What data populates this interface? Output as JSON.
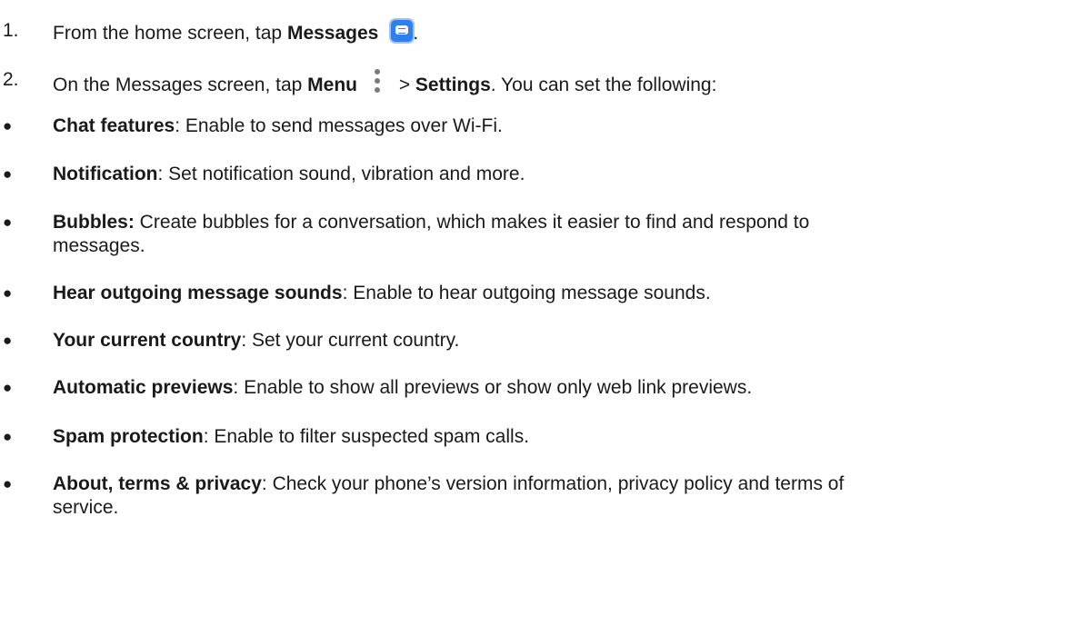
{
  "steps": [
    {
      "number": "1.",
      "prefix": "From the home screen, tap ",
      "bold": "Messages",
      "icon": "messages-icon",
      "suffix": "."
    },
    {
      "number": "2.",
      "prefix": "On the Messages screen, tap ",
      "bold": "Menu",
      "icon": "more-vert-icon",
      "middle": " > ",
      "bold2": "Settings",
      "suffix": ". You can set the following:"
    }
  ],
  "bullet_symbol": "●",
  "settings": [
    {
      "term": "Chat features",
      "desc": ": Enable to send messages over Wi-Fi."
    },
    {
      "term": "Notification",
      "desc": ": Set notification sound, vibration and more."
    },
    {
      "term": "Bubbles:",
      "desc": " Create bubbles for a conversation, which makes it easier to find and respond to",
      "desc2": "messages."
    },
    {
      "term": "Hear outgoing message sounds",
      "desc": ": Enable to hear outgoing message sounds."
    },
    {
      "term": "Your current country",
      "desc": ": Set your current country."
    },
    {
      "term": "Automatic previews",
      "desc": ": Enable to show all previews or show only web link previews."
    },
    {
      "term": "Spam protection",
      "desc": ": Enable to filter suspected spam calls."
    },
    {
      "term": "About, terms & privacy",
      "desc": ": Check your phone’s version information, privacy policy and terms of",
      "desc2": "service."
    }
  ],
  "colors": {
    "messages_icon": "#2f80ed",
    "menu_icon": "#7a7a7a"
  }
}
